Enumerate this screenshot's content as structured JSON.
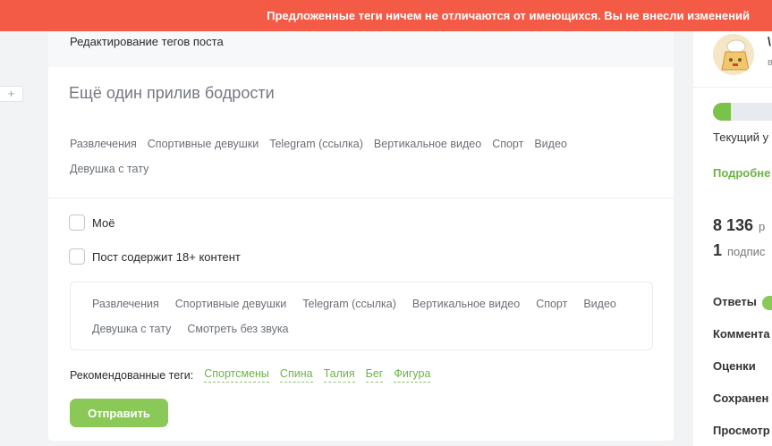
{
  "toast": {
    "message": "Предложенные теги ничем не отличаются от имеющихся. Вы не внесли изменений"
  },
  "left_plus": {
    "label": "+"
  },
  "editor": {
    "header_title": "Редактирование тегов поста",
    "post_title": "Ещё один прилив бодрости",
    "current_tags": [
      "Развлечения",
      "Спортивные девушки",
      "Telegram (ссылка)",
      "Вертикальное видео",
      "Спорт",
      "Видео",
      "Девушка с тату"
    ],
    "checkbox_mine": "Моё",
    "checkbox_nsfw": "Пост содержит 18+ контент",
    "edit_tags": [
      "Развлечения",
      "Спортивные девушки",
      "Telegram (ссылка)",
      "Вертикальное видео",
      "Спорт",
      "Видео",
      "Девушка с тату",
      "Смотреть без звука"
    ],
    "recommended_label": "Рекомендованные теги:",
    "recommended_tags": [
      "Спортсмены",
      "Спина",
      "Талия",
      "Бег",
      "Фигура"
    ],
    "submit_label": "Отправить"
  },
  "sidebar": {
    "name_fragment": "\\",
    "sub_fragment": "в",
    "progress_fraction": 0.25,
    "level_text": "Текущий у",
    "details_link": "Подробне",
    "rating_value": "8 136",
    "rating_suffix": "р",
    "subscribers_value": "1",
    "subscribers_suffix": "подпис",
    "menu": [
      "Ответы",
      "Коммента",
      "Оценки",
      "Сохранен",
      "Просмотр"
    ]
  },
  "colors": {
    "toast_bg": "#f45b47",
    "accent_green": "#8ac858",
    "link_green": "#6cb346"
  }
}
